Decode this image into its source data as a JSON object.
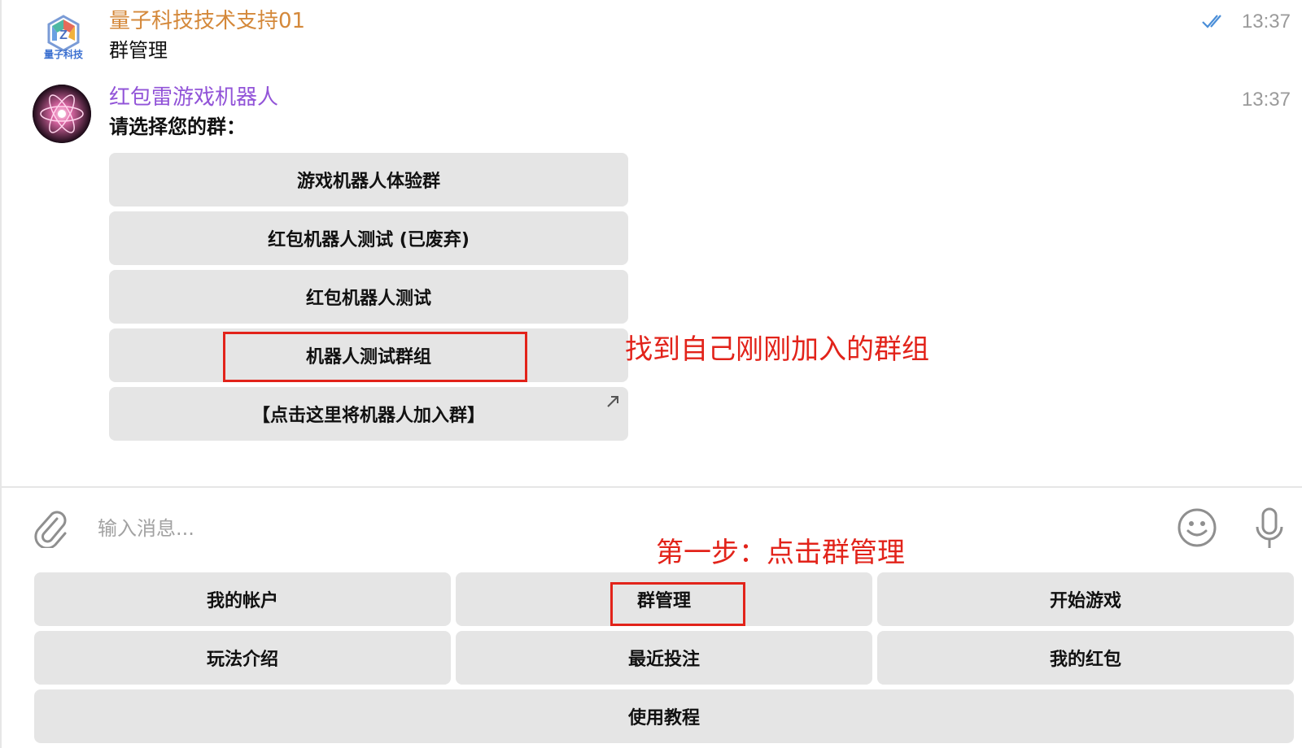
{
  "messages": [
    {
      "sender": "量子科技技术支持01",
      "sender_color": "#d4883a",
      "avatar_caption": "量子科技",
      "text": "群管理",
      "time": "13:37",
      "read_status": "double-check-icon"
    },
    {
      "sender": "红包雷游戏机器人",
      "sender_color": "#9254d8",
      "text": "请选择您的群：",
      "time": "13:37",
      "inline_buttons": [
        {
          "label": "游戏机器人体验群"
        },
        {
          "label": "红包机器人测试 (已废弃)"
        },
        {
          "label": "红包机器人测试"
        },
        {
          "label": "机器人测试群组"
        },
        {
          "label": "【点击这里将机器人加入群】",
          "icon": "external-arrow-icon"
        }
      ]
    }
  ],
  "annotations": {
    "find_group": "找到自己刚刚加入的群组",
    "step_one": "第一步：点击群管理",
    "color": "#e2231a"
  },
  "composer": {
    "placeholder": "输入消息...",
    "attach_icon": "paperclip-icon",
    "emoji_icon": "emoji-icon",
    "mic_icon": "microphone-icon"
  },
  "keyboard": {
    "row1": [
      "我的帐户",
      "群管理",
      "开始游戏"
    ],
    "row2": [
      "玩法介绍",
      "最近投注",
      "我的红包"
    ],
    "row3": [
      "使用教程"
    ]
  },
  "colors": {
    "button_bg": "#e5e5e5",
    "check_blue": "#4a8ed8"
  }
}
